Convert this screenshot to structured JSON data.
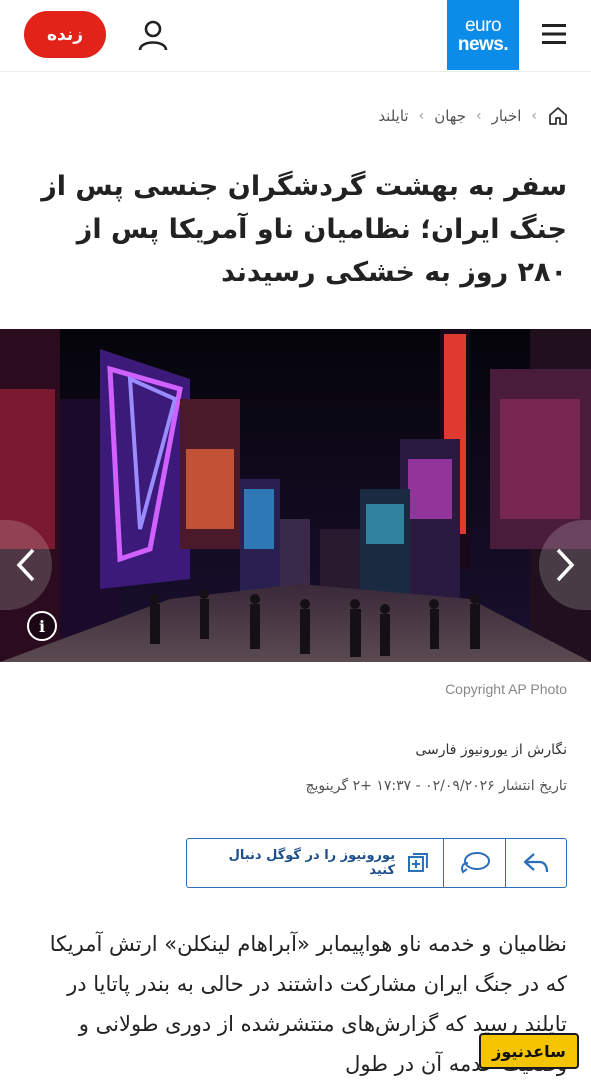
{
  "header": {
    "live_label": "زنده",
    "logo_line1": "euro",
    "logo_line2": "news."
  },
  "breadcrumb": {
    "items": [
      "اخبار",
      "جهان",
      "تایلند"
    ]
  },
  "article": {
    "title": "سفر به بهشت گردشگران جنسی پس از جنگ ایران؛ نظامیان ناو آمریکا پس از ۲۸۰ روز به خشکی رسیدند",
    "image_credit": "Copyright AP Photo",
    "byline": "نگارش از یورونیوز فارسی",
    "published": "تاریخ انتشار ۰۲/۰۹/۲۰۲۶ - ۱۷:۳۷ +۲ گرینویچ",
    "body": "نظامیان و خدمه ناو هواپیمابر «آبراهام لینکلن» ارتش آمریکا که در جنگ ایران مشارکت داشتند در حالی به بندر پاتایا در تایلند رسید که گزارش‌های منتشرشده از دوری طولانی و وضعیت خدمه آن در طول"
  },
  "share": {
    "google_follow_label": "یورونیوز را در گوگل دنبال کنید"
  },
  "watermark": {
    "text": "ساعدنیوز"
  },
  "colors": {
    "live_red": "#e2231a",
    "brand_blue": "#0b8ce9",
    "share_border": "#2a6fb7"
  }
}
